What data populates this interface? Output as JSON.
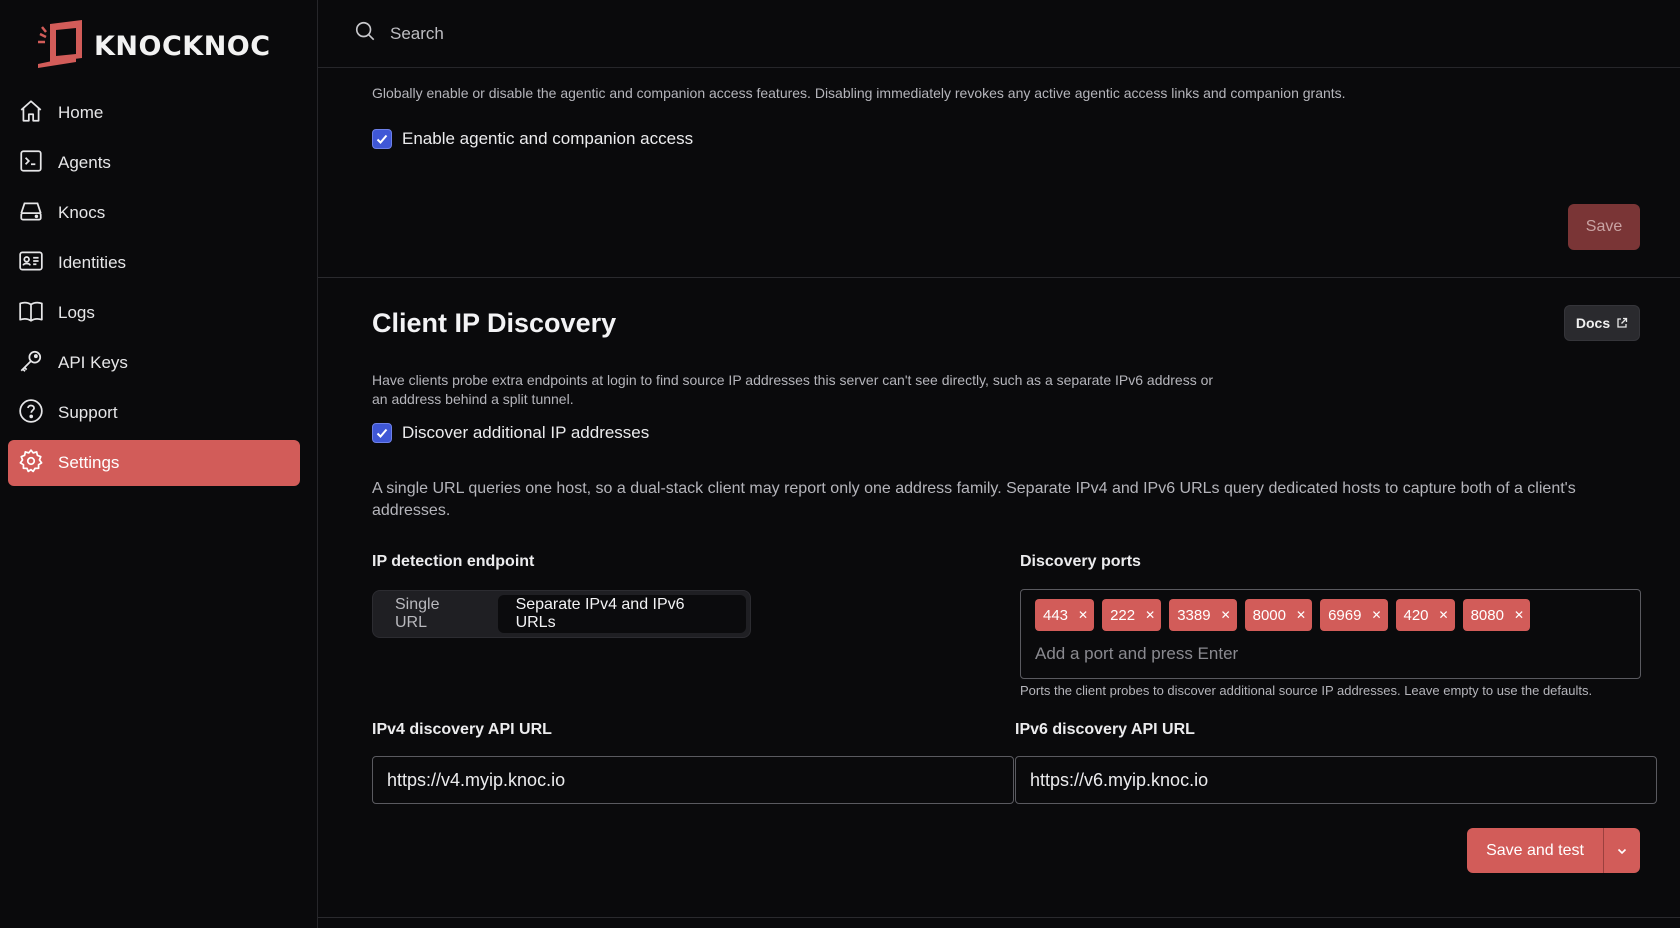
{
  "brand": {
    "name": "KNOCKNOC",
    "accent": "#d25c59"
  },
  "search": {
    "placeholder": "Search"
  },
  "sidebar": {
    "items": [
      {
        "label": "Home",
        "icon": "home-icon",
        "active": false
      },
      {
        "label": "Agents",
        "icon": "terminal-icon",
        "active": false
      },
      {
        "label": "Knocs",
        "icon": "hard-drive-icon",
        "active": false
      },
      {
        "label": "Identities",
        "icon": "id-card-icon",
        "active": false
      },
      {
        "label": "Logs",
        "icon": "book-icon",
        "active": false
      },
      {
        "label": "API Keys",
        "icon": "key-icon",
        "active": false
      },
      {
        "label": "Support",
        "icon": "help-circle-icon",
        "active": false
      },
      {
        "label": "Settings",
        "icon": "gear-icon",
        "active": true
      }
    ]
  },
  "agentic": {
    "description": "Globally enable or disable the agentic and companion access features. Disabling immediately revokes any active agentic access links and companion grants.",
    "checkbox_label": "Enable agentic and companion access",
    "checked": true,
    "save_label": "Save"
  },
  "discovery": {
    "title": "Client IP Discovery",
    "docs_label": "Docs",
    "description": "Have clients probe extra endpoints at login to find source IP addresses this server can't see directly, such as a separate IPv6 address or an address behind a split tunnel.",
    "checkbox_label": "Discover additional IP addresses",
    "checked": true,
    "explainer": "A single URL queries one host, so a dual-stack client may report only one address family. Separate IPv4 and IPv6 URLs query dedicated hosts to capture both of a client's addresses.",
    "endpoint_label": "IP detection endpoint",
    "endpoint_options": [
      "Single URL",
      "Separate IPv4 and IPv6 URLs"
    ],
    "endpoint_selected": "Separate IPv4 and IPv6 URLs",
    "ports_label": "Discovery ports",
    "ports": [
      "443",
      "222",
      "3389",
      "8000",
      "6969",
      "420",
      "8080"
    ],
    "ports_placeholder": "Add a port and press Enter",
    "ports_help": "Ports the client probes to discover additional source IP addresses. Leave empty to use the defaults.",
    "ipv4_label": "IPv4 discovery API URL",
    "ipv4_value": "https://v4.myip.knoc.io",
    "ipv6_label": "IPv6 discovery API URL",
    "ipv6_value": "https://v6.myip.knoc.io",
    "save_test_label": "Save and test"
  }
}
